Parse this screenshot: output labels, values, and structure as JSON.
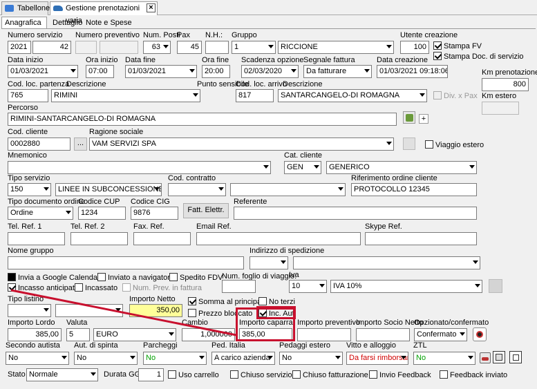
{
  "tabs": {
    "t1": "Tabellone",
    "t2": "Gestione prenotazioni varia"
  },
  "subtabs": {
    "s1": "Anagrafica",
    "s2": "Dettaglio",
    "s3": "Note e Spese"
  },
  "labels": {
    "num_servizio": "Numero servizio",
    "num_preventivo": "Numero preventivo",
    "num_posti": "Num. Posti",
    "pax": "Pax",
    "nh": "N.H.:",
    "gruppo": "Gruppo",
    "utente_creazione": "Utente creazione",
    "data_inizio": "Data inizio",
    "ora_inizio": "Ora inizio",
    "data_fine": "Data fine",
    "ora_fine": "Ora fine",
    "scadenza_opzione": "Scadenza opzione",
    "segnale_fattura": "Segnale fattura",
    "data_creazione": "Data creazione",
    "km_prenotazione": "Km prenotazione",
    "cod_loc_partenza": "Cod. loc. partenza",
    "descrizione": "Descrizione",
    "punto_sensibile": "Punto sensibile",
    "cod_loc_arrivo": "Cod. loc. arrivo",
    "descrizione2": "Descrizione",
    "km_estero": "Km estero",
    "percorso": "Percorso",
    "cod_cliente": "Cod. cliente",
    "ragione_sociale": "Ragione sociale",
    "mnemonico": "Mnemonico",
    "cat_cliente": "Cat. cliente",
    "tipo_servizio": "Tipo servizio",
    "cod_contratto": "Cod. contratto",
    "rif_ordine": "Riferimento ordine cliente",
    "tipo_doc_ordine": "Tipo documento ordine",
    "codice_cup": "Codice CUP",
    "codice_cig": "Codice CIG",
    "referente": "Referente",
    "tel1": "Tel. Ref. 1",
    "tel2": "Tel. Ref. 2",
    "fax": "Fax. Ref.",
    "email": "Email Ref.",
    "skype": "Skype Ref.",
    "nome_gruppo": "Nome gruppo",
    "indirizzo_spedizione": "Indirizzo di spedizione",
    "num_foglio": "Num. foglio di viaggio:",
    "iva": "Iva",
    "tipo_listino": "Tipo listino",
    "importo_netto": "Importo Netto",
    "importo_lordo": "Importo Lordo",
    "valuta": "Valuta",
    "cambio": "Cambio",
    "importo_caparra": "Importo caparra",
    "importo_preventivo": "Importo preventivo",
    "importo_socio": "Importo Socio Netto",
    "opzionato": "Opzionato/confermato",
    "secondo_autista": "Secondo autista",
    "aut_spinta": "Aut. di spinta",
    "parcheggi": "Parcheggi",
    "ped_italia": "Ped. Italia",
    "pedaggi_estero": "Pedaggi estero",
    "vitto": "Vitto e alloggio",
    "ztl": "ZTL",
    "stato": "Stato",
    "durata": "Durata GG"
  },
  "values": {
    "num_servizio_anno": "2021",
    "num_servizio": "42",
    "num_posti": "63",
    "pax": "45",
    "gruppo_num": "1",
    "gruppo": "RICCIONE",
    "utente": "100",
    "data_inizio": "01/03/2021",
    "ora_inizio": "07:00",
    "data_fine": "01/03/2021",
    "ora_fine": "20:00",
    "scadenza": "02/03/2020",
    "segnale": "Da fatturare",
    "data_creazione": "01/03/2021 09:18:06",
    "km_prenotazione": "800",
    "cod_partenza": "765",
    "desc_partenza": "RIMINI",
    "cod_arrivo": "817",
    "desc_arrivo": "SANTARCANGELO-DI ROMAGNA",
    "percorso": "RIMINI-SANTARCANGELO-DI ROMAGNA",
    "cod_cliente": "0002880",
    "ragione_sociale": "VAM SERVIZI SPA",
    "cat_cliente_cod": "GEN",
    "cat_cliente": "GENERICO",
    "tipo_servizio_cod": "150",
    "tipo_servizio": "LINEE IN SUBCONCESSIONE",
    "rif_ordine": "PROTOCOLLO 12345",
    "tipo_doc": "Ordine",
    "cup": "1234",
    "cig": "9876",
    "fatt_btn": "Fatt. Elettr.",
    "iva_cod": "10",
    "iva": "IVA 10%",
    "importo_netto": "350,00",
    "importo_lordo": "385,00",
    "valuta_num": "5",
    "valuta": "EURO",
    "cambio": "1,000000",
    "caparra": "385,00",
    "opzionato": "Confermato",
    "secondo_autista": "No",
    "aut_spinta": "No",
    "parcheggi": "No",
    "ped_italia": "A carico azienda",
    "pedaggi_estero": "No",
    "vitto": "Da farsi rimborsare",
    "ztl": "No",
    "stato": "Normale",
    "durata": "1"
  },
  "checks": {
    "stampa_fv": "Stampa FV",
    "stampa_doc": "Stampa Doc. di servizio",
    "div_pax": "Div. x Pax",
    "viaggio_estero": "Viaggio estero",
    "google": "Invia a Google Calendar",
    "navigatore": "Inviato a navigatore",
    "fdv": "Spedito FDV",
    "incasso_ant": "Incasso anticipato",
    "incassato": "Incassato",
    "num_prev": "Num. Prev. in fattura",
    "somma": "Somma al principale",
    "no_terzi": "No terzi",
    "prezzo_bloccato": "Prezzo bloccato",
    "inc_aut": "Inc. Aut.",
    "uso_carrello": "Uso carrello",
    "chiuso_servizio": "Chiuso servizio",
    "chiuso_fatt": "Chiuso fatturazione",
    "invio_feedback": "Invio Feedback",
    "feedback_inviato": "Feedback inviato"
  },
  "colors": {
    "highlight": "#d00000",
    "yellow": "#ffff99"
  }
}
